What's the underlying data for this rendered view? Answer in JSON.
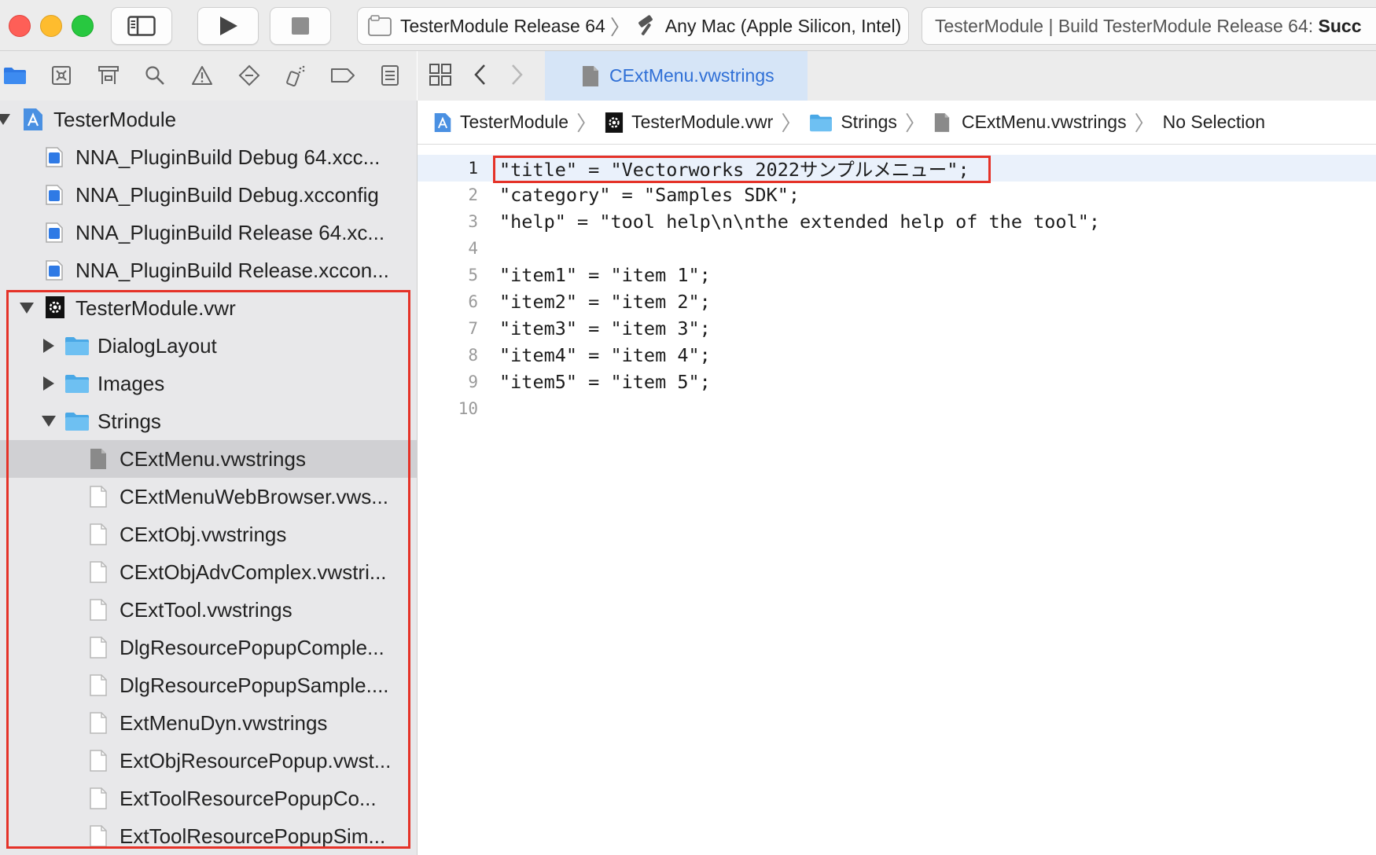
{
  "toolbar": {
    "scheme_target": "TesterModule Release 64",
    "scheme_destination": "Any Mac (Apple Silicon, Intel)",
    "status_text": "TesterModule | Build TesterModule Release 64: ",
    "status_bold": "Succ"
  },
  "navigator": {
    "project": "TesterModule",
    "items": [
      {
        "label": "NNA_PluginBuild Debug 64.xcc..."
      },
      {
        "label": "NNA_PluginBuild Debug.xcconfig"
      },
      {
        "label": "NNA_PluginBuild Release 64.xc..."
      },
      {
        "label": "NNA_PluginBuild Release.xccon..."
      },
      {
        "label": "TesterModule.vwr"
      },
      {
        "label": "DialogLayout"
      },
      {
        "label": "Images"
      },
      {
        "label": "Strings"
      },
      {
        "label": "CExtMenu.vwstrings"
      },
      {
        "label": "CExtMenuWebBrowser.vws..."
      },
      {
        "label": "CExtObj.vwstrings"
      },
      {
        "label": "CExtObjAdvComplex.vwstri..."
      },
      {
        "label": "CExtTool.vwstrings"
      },
      {
        "label": "DlgResourcePopupComple..."
      },
      {
        "label": "DlgResourcePopupSample...."
      },
      {
        "label": "ExtMenuDyn.vwstrings"
      },
      {
        "label": "ExtObjResourcePopup.vwst..."
      },
      {
        "label": "ExtToolResourcePopupCo..."
      },
      {
        "label": "ExtToolResourcePopupSim..."
      }
    ]
  },
  "editor": {
    "tab_title": "CExtMenu.vwstrings",
    "jumpbar": {
      "project": "TesterModule",
      "bundle": "TesterModule.vwr",
      "folder": "Strings",
      "file": "CExtMenu.vwstrings",
      "selection": "No Selection"
    },
    "lines": [
      {
        "n": "1",
        "code": "\"title\" = \"Vectorworks 2022サンプルメニュー\";"
      },
      {
        "n": "2",
        "code": "\"category\" = \"Samples SDK\";"
      },
      {
        "n": "3",
        "code": "\"help\" = \"tool help\\n\\nthe extended help of the tool\";"
      },
      {
        "n": "4",
        "code": ""
      },
      {
        "n": "5",
        "code": "\"item1\" = \"item 1\";"
      },
      {
        "n": "6",
        "code": "\"item2\" = \"item 2\";"
      },
      {
        "n": "7",
        "code": "\"item3\" = \"item 3\";"
      },
      {
        "n": "8",
        "code": "\"item4\" = \"item 4\";"
      },
      {
        "n": "9",
        "code": "\"item5\" = \"item 5\";"
      },
      {
        "n": "10",
        "code": ""
      }
    ]
  },
  "colors": {
    "annotation_red": "#e53228",
    "accent_blue": "#2f6fd6",
    "folder_blue": "#5fb8ee"
  }
}
